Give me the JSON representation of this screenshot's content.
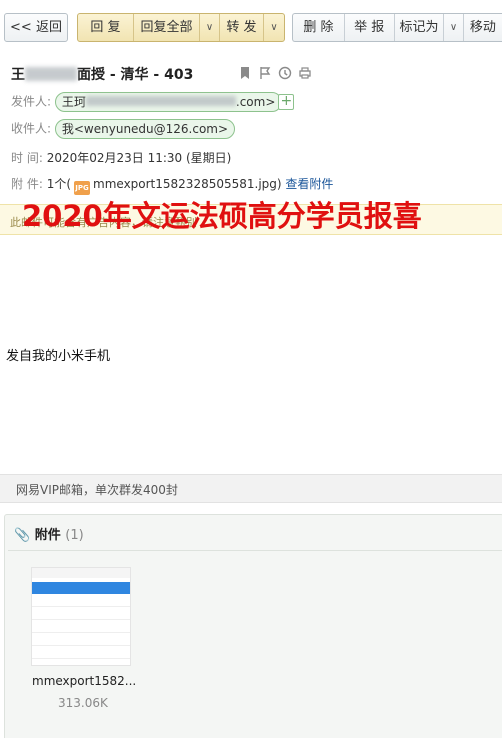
{
  "toolbar": {
    "back_label": "<< 返回",
    "reply_label": "回 复",
    "reply_all_label": "回复全部",
    "forward_label": "转 发",
    "delete_label": "删 除",
    "report_label": "举 报",
    "mark_label": "标记为",
    "move_label": "移动",
    "dropdown_glyph": "∨"
  },
  "email": {
    "subject_prefix": "王",
    "subject_suffix": "面授 - 清华 - 403",
    "from_label": "发件人:",
    "from_value_visible": "王珂",
    "from_value_tail": ".com>",
    "to_label": "收件人:",
    "to_value": "我<wenyunedu@126.com>",
    "time_label": "时  间:",
    "time_value": "2020年02月23日 11:30 (星期日)",
    "attach_label": "附  件:",
    "attach_count": "1个",
    "attach_open": "(",
    "attach_file": "mmexport1582328505581.jpg",
    "attach_close": ")",
    "view_attach_link": "查看附件"
  },
  "notice_bar_text": "此邮件可能含有广告内容，请注意甄别",
  "banner_text": "2020年文运法硕高分学员报喜",
  "body_text": "发自我的小米手机",
  "vip_text": "网易VIP邮箱，单次群发400封",
  "attachments": {
    "title": "附件",
    "count": "(1)",
    "items": [
      {
        "name": "mmexport1582...",
        "size": "313.06K"
      }
    ]
  },
  "colors": {
    "banner": "#e01010",
    "link": "#1a5599",
    "pill_border": "#8dc28d"
  }
}
